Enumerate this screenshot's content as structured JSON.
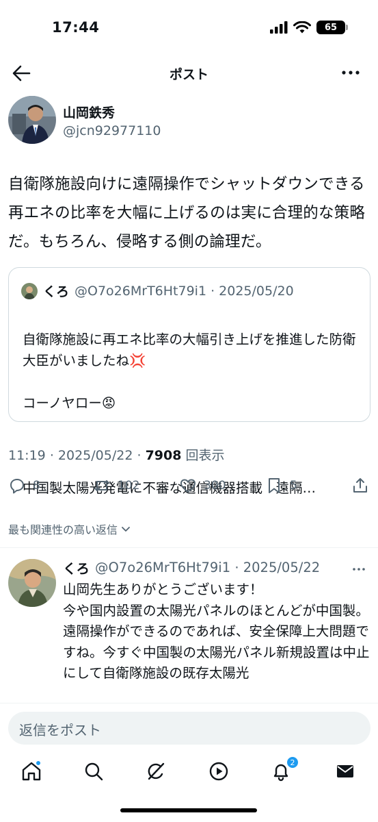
{
  "status_bar": {
    "time": "17:44",
    "battery": "65"
  },
  "header": {
    "title": "ポスト"
  },
  "author": {
    "name": "山岡鉄秀",
    "handle": "@jcn92977110"
  },
  "post": {
    "text": "自衛隊施設向けに遠隔操作でシャットダウンできる再エネの比率を大幅に上げるのは実に合理的な策略だ。もちろん、侵略する側の論理だ。",
    "time": "11:19",
    "date": "2025/05/22",
    "views": "7908",
    "views_label": "回表示"
  },
  "quote": {
    "name": "くろ",
    "handle": "@O7o26MrT6Ht79i1",
    "date": "2025/05/20",
    "lines": [
      "自衛隊施設に再エネ比率の大幅引き上げを推進した防衛大臣がいましたね💢",
      "コーノヤロー😡",
      "",
      "中国製太陽光発電に不審な通信機器搭載　遠隔…"
    ]
  },
  "actions": {
    "replies": "8",
    "reposts": "102",
    "likes": "300",
    "bookmarks": "5"
  },
  "sort_label": "最も関連性の高い返信",
  "reply": {
    "name": "くろ",
    "handle": "@O7o26MrT6Ht79i1",
    "date": "2025/05/22",
    "text": "山岡先生ありがとうございます！\n今や国内設置の太陽光パネルのほとんどが中国製。\n遠隔操作ができるのであれば、安全保障上大問題ですね。今すぐ中国製の太陽光パネル新規設置は中止にして自衛隊施設の既存太陽光"
  },
  "compose": {
    "placeholder": "返信をポスト"
  },
  "tabbar": {
    "notification_count": "2"
  },
  "colors": {
    "accent": "#1d9bf0",
    "secondary_text": "#536471",
    "angry": "#e0245e"
  }
}
